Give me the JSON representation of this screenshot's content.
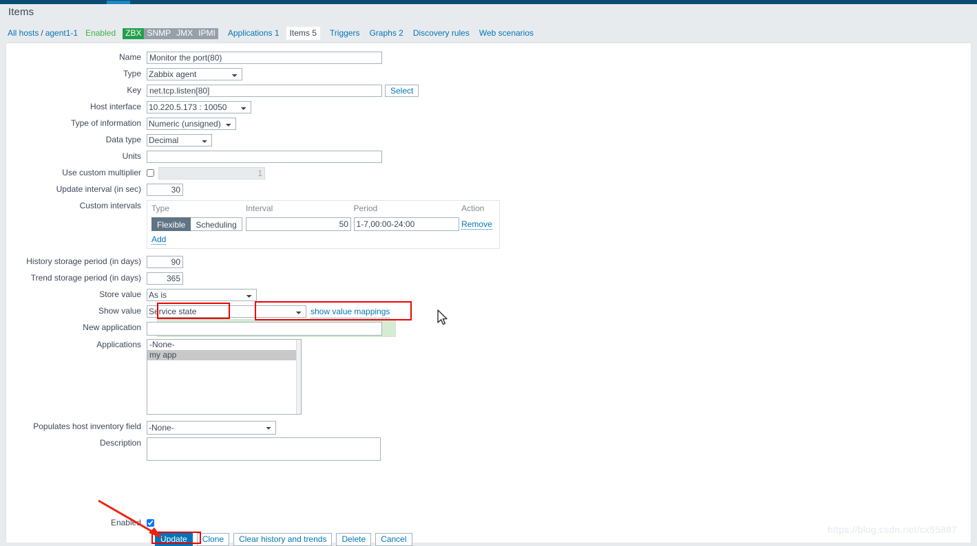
{
  "page": {
    "title": "Items",
    "watermark": "https://blog.csdn.net/cx55887"
  },
  "hostnav": {
    "all_hosts": "All hosts",
    "separator": "/",
    "host": "agent1-1",
    "status": "Enabled",
    "interfaces": [
      {
        "label": "ZBX",
        "active": true
      },
      {
        "label": "SNMP",
        "active": false
      },
      {
        "label": "JMX",
        "active": false
      },
      {
        "label": "IPMI",
        "active": false
      }
    ],
    "links": [
      {
        "label": "Applications 1",
        "active": false
      },
      {
        "label": "Items 5",
        "active": true
      },
      {
        "label": "Triggers",
        "active": false
      },
      {
        "label": "Graphs 2",
        "active": false
      },
      {
        "label": "Discovery rules",
        "active": false
      },
      {
        "label": "Web scenarios",
        "active": false
      }
    ]
  },
  "form": {
    "name_label": "Name",
    "name_value": "Monitor the port(80)",
    "type_label": "Type",
    "type_value": "Zabbix agent",
    "key_label": "Key",
    "key_value": "net.tcp.listen[80]",
    "select_button": "Select",
    "host_interface_label": "Host interface",
    "host_interface_value": "10.220.5.173 : 10050",
    "type_of_information_label": "Type of information",
    "type_of_information_value": "Numeric (unsigned)",
    "data_type_label": "Data type",
    "data_type_value": "Decimal",
    "units_label": "Units",
    "units_value": "",
    "custom_multiplier_label": "Use custom multiplier",
    "custom_multiplier_checked": false,
    "custom_multiplier_value": "1",
    "update_interval_label": "Update interval (in sec)",
    "update_interval_value": "30",
    "custom_intervals_label": "Custom intervals",
    "custom_intervals": {
      "col_type": "Type",
      "col_interval": "Interval",
      "col_period": "Period",
      "col_action": "Action",
      "seg_flexible": "Flexible",
      "seg_scheduling": "Scheduling",
      "selected_seg": "Flexible",
      "interval_value": "50",
      "period_value": "1-7,00:00-24:00",
      "remove_label": "Remove",
      "add_label": "Add"
    },
    "history_label": "History storage period (in days)",
    "history_value": "90",
    "trend_label": "Trend storage period (in days)",
    "trend_value": "365",
    "store_value_label": "Store value",
    "store_value_value": "As is",
    "show_value_label": "Show value",
    "show_value_value": "Service state",
    "show_value_mappings_link": "show value mappings",
    "new_application_label": "New application",
    "new_application_value": "",
    "applications_label": "Applications",
    "applications_options": [
      {
        "label": "-None-",
        "selected": false
      },
      {
        "label": "my app",
        "selected": true
      }
    ],
    "host_inventory_label": "Populates host inventory field",
    "host_inventory_value": "-None-",
    "description_label": "Description",
    "description_value": "",
    "enabled_label": "Enabled",
    "enabled_checked": true
  },
  "buttons": {
    "update": "Update",
    "clone": "Clone",
    "clear_history": "Clear history and trends",
    "delete": "Delete",
    "cancel": "Cancel"
  },
  "colors": {
    "accent": "#0275b8",
    "navy": "#0a4d72",
    "green": "#22a04a",
    "annotation_red": "#ee0000",
    "highlight_green": "#d5ecd3"
  }
}
